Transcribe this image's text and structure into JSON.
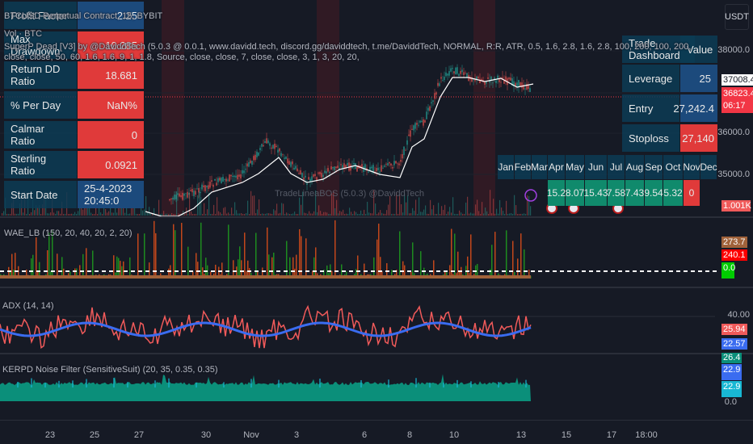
{
  "symbol_legend": "BTCUSD Perpetual Contract, 15, BYBIT",
  "volume_legend": "Vol · BTC",
  "indicator_legend": "SuperP Dead [V3] by @DaviddTech (5.0.3 @ 0.0.1, www.davidd.tech, discord.gg/daviddtech, t.me/DaviddTech, NORMAL, R:R, ATR, 0.5, 1.6, 2.8, 1.6, 2.8, 100, 200, 100, 200, close, close, 50, 60, 1.6, 1.6, 9, 1, 1.8, Source, close, close, 7, close, close, 3, 1, 3, 20, 20,",
  "watermark": "TradeLineaBOS (5.0.3) @DaviddTech",
  "currency": "USDT",
  "stats_table": [
    {
      "label": "Profit Factor",
      "value": "2.25",
      "color": "blue"
    },
    {
      "label": "Max Drawdown",
      "value": "10.285",
      "color": "red"
    },
    {
      "label": "Return DD Ratio",
      "value": "18.681",
      "color": "red"
    },
    {
      "label": "% Per Day",
      "value": "NaN%",
      "color": "red"
    },
    {
      "label": "Calmar Ratio",
      "value": "0",
      "color": "red"
    },
    {
      "label": "Sterling Ratio",
      "value": "0.0921",
      "color": "red"
    },
    {
      "label": "Start Date",
      "value": "25-4-2023 20:45:0",
      "color": "blue"
    }
  ],
  "trade_dashboard": {
    "header": "Trade Dashboard",
    "value_header": "Value",
    "rows": [
      {
        "label": "Leverage",
        "value": "25",
        "color": "blue"
      },
      {
        "label": "Entry",
        "value": "27,242.4",
        "color": "blue"
      },
      {
        "label": "Stoploss",
        "value": "27,140",
        "color": "red"
      }
    ]
  },
  "monthly": {
    "months": [
      "Jan",
      "Feb",
      "Mar",
      "Apr",
      "May",
      "Jun",
      "Jul",
      "Aug",
      "Sep",
      "Oct",
      "Nov",
      "Dec"
    ],
    "values": [
      {
        "v": "15.2",
        "color": "green"
      },
      {
        "v": "8.07",
        "color": "green"
      },
      {
        "v": "15.43",
        "color": "green"
      },
      {
        "v": "7.58",
        "color": "green"
      },
      {
        "v": "7.43",
        "color": "green"
      },
      {
        "v": "9.54",
        "color": "green"
      },
      {
        "v": "5.32",
        "color": "green"
      },
      {
        "v": "0",
        "color": "red"
      }
    ]
  },
  "price_axis": {
    "p38000": "38000.0",
    "p36000": "36000.0",
    "p35000": "35000.0",
    "last": "37008.4",
    "current": "36823.4",
    "countdown": "06:17",
    "volume": "1.001K"
  },
  "wae": {
    "legend": "WAE_LB (150, 20, 40, 20, 2, 20)",
    "v1": "273.7",
    "v2": "240.1",
    "v3": "0.0"
  },
  "adx": {
    "legend": "ADX (14, 14)",
    "level": "40.00",
    "v1": "25.94",
    "v2": "22.57"
  },
  "kerpd": {
    "legend": "KERPD Noise Filter (SensitiveSuit) (20, 35, 0.35, 0.35)",
    "v1": "26.4",
    "v2": "22.9",
    "v3": "22.9",
    "zero": "0.0"
  },
  "time_axis": [
    "23",
    "25",
    "27",
    "30",
    "Nov",
    "3",
    "6",
    "8",
    "10",
    "13",
    "15",
    "17",
    "18:00"
  ],
  "colors": {
    "bg": "#161a25",
    "up": "#26a69a",
    "down": "#ef5350",
    "adx_red": "#f05a5a",
    "adx_blue": "#3a6cf0",
    "teal": "#0b8f7a"
  }
}
